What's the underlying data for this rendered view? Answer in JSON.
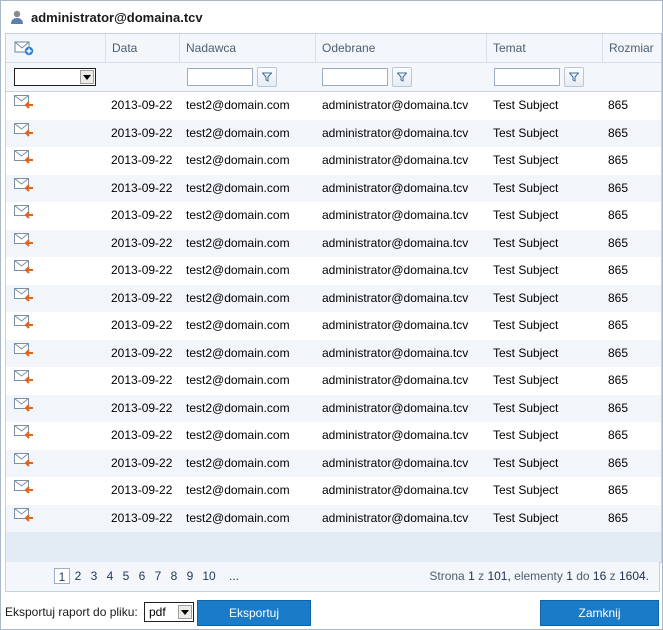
{
  "window": {
    "title": "administrator@domaina.tcv"
  },
  "columns": {
    "date": "Data",
    "sender": "Nadawca",
    "recipient": "Odebrane",
    "subject": "Temat",
    "size": "Rozmiar"
  },
  "rows": [
    {
      "date": "2013-09-22",
      "sender": "test2@domain.com",
      "recipient": "administrator@domaina.tcv",
      "subject": "Test Subject",
      "size": "865"
    },
    {
      "date": "2013-09-22",
      "sender": "test2@domain.com",
      "recipient": "administrator@domaina.tcv",
      "subject": "Test Subject",
      "size": "865"
    },
    {
      "date": "2013-09-22",
      "sender": "test2@domain.com",
      "recipient": "administrator@domaina.tcv",
      "subject": "Test Subject",
      "size": "865"
    },
    {
      "date": "2013-09-22",
      "sender": "test2@domain.com",
      "recipient": "administrator@domaina.tcv",
      "subject": "Test Subject",
      "size": "865"
    },
    {
      "date": "2013-09-22",
      "sender": "test2@domain.com",
      "recipient": "administrator@domaina.tcv",
      "subject": "Test Subject",
      "size": "865"
    },
    {
      "date": "2013-09-22",
      "sender": "test2@domain.com",
      "recipient": "administrator@domaina.tcv",
      "subject": "Test Subject",
      "size": "865"
    },
    {
      "date": "2013-09-22",
      "sender": "test2@domain.com",
      "recipient": "administrator@domaina.tcv",
      "subject": "Test Subject",
      "size": "865"
    },
    {
      "date": "2013-09-22",
      "sender": "test2@domain.com",
      "recipient": "administrator@domaina.tcv",
      "subject": "Test Subject",
      "size": "865"
    },
    {
      "date": "2013-09-22",
      "sender": "test2@domain.com",
      "recipient": "administrator@domaina.tcv",
      "subject": "Test Subject",
      "size": "865"
    },
    {
      "date": "2013-09-22",
      "sender": "test2@domain.com",
      "recipient": "administrator@domaina.tcv",
      "subject": "Test Subject",
      "size": "865"
    },
    {
      "date": "2013-09-22",
      "sender": "test2@domain.com",
      "recipient": "administrator@domaina.tcv",
      "subject": "Test Subject",
      "size": "865"
    },
    {
      "date": "2013-09-22",
      "sender": "test2@domain.com",
      "recipient": "administrator@domaina.tcv",
      "subject": "Test Subject",
      "size": "865"
    },
    {
      "date": "2013-09-22",
      "sender": "test2@domain.com",
      "recipient": "administrator@domaina.tcv",
      "subject": "Test Subject",
      "size": "865"
    },
    {
      "date": "2013-09-22",
      "sender": "test2@domain.com",
      "recipient": "administrator@domaina.tcv",
      "subject": "Test Subject",
      "size": "865"
    },
    {
      "date": "2013-09-22",
      "sender": "test2@domain.com",
      "recipient": "administrator@domaina.tcv",
      "subject": "Test Subject",
      "size": "865"
    },
    {
      "date": "2013-09-22",
      "sender": "test2@domain.com",
      "recipient": "administrator@domaina.tcv",
      "subject": "Test Subject",
      "size": "865"
    }
  ],
  "pager": {
    "pages": [
      "1",
      "2",
      "3",
      "4",
      "5",
      "6",
      "7",
      "8",
      "9",
      "10",
      "..."
    ],
    "current": "1",
    "label_page": "Strona",
    "page": "1",
    "label_of": "z",
    "page_total": "101,",
    "label_items": "elementy",
    "items_from": "1",
    "label_to": "do",
    "items_to": "16",
    "label_of2": "z",
    "items_total": "1604."
  },
  "export": {
    "label": "Eksportuj raport do pliku:",
    "format": "pdf",
    "button": "Eksportuj"
  },
  "close_button": "Zamknij",
  "icons": {
    "title": "user-icon",
    "header": "mail-add-icon",
    "row": "mail-incoming-icon",
    "filter": "funnel-icon"
  },
  "colors": {
    "accent": "#1a7bc8",
    "header_bg": "#f3f6fa",
    "row_alt": "#f2f5f9"
  }
}
